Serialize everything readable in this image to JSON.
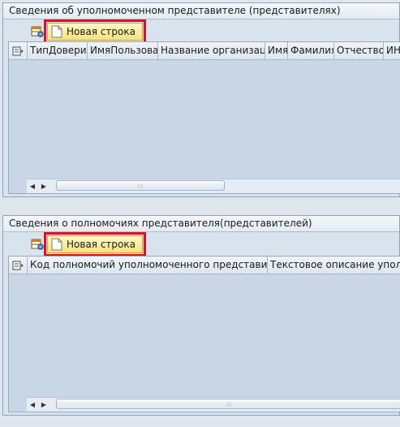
{
  "panel1": {
    "title": "Сведения об уполномоченном представителе (представителях)",
    "new_row_label": "Новая строка",
    "columns": [
      "ТипДоверит",
      "ИмяПользоват",
      "Название организации",
      "Имя",
      "Фамилия",
      "Отчество",
      "ИНН"
    ]
  },
  "panel2": {
    "title": "Сведения о полномочиях представителя(представителей)",
    "new_row_label": "Новая строка",
    "columns": [
      "Код полномочий уполномоченного представителя",
      "Текстовое описание уполно"
    ]
  },
  "scroll": {
    "grip": ":::"
  },
  "colors": {
    "highlight": "#e0101e",
    "button": "#f6e27a"
  },
  "icons": [
    "table-settings-icon",
    "new-document-icon",
    "select-column-icon",
    "scroll-left-icon",
    "scroll-right-icon"
  ]
}
